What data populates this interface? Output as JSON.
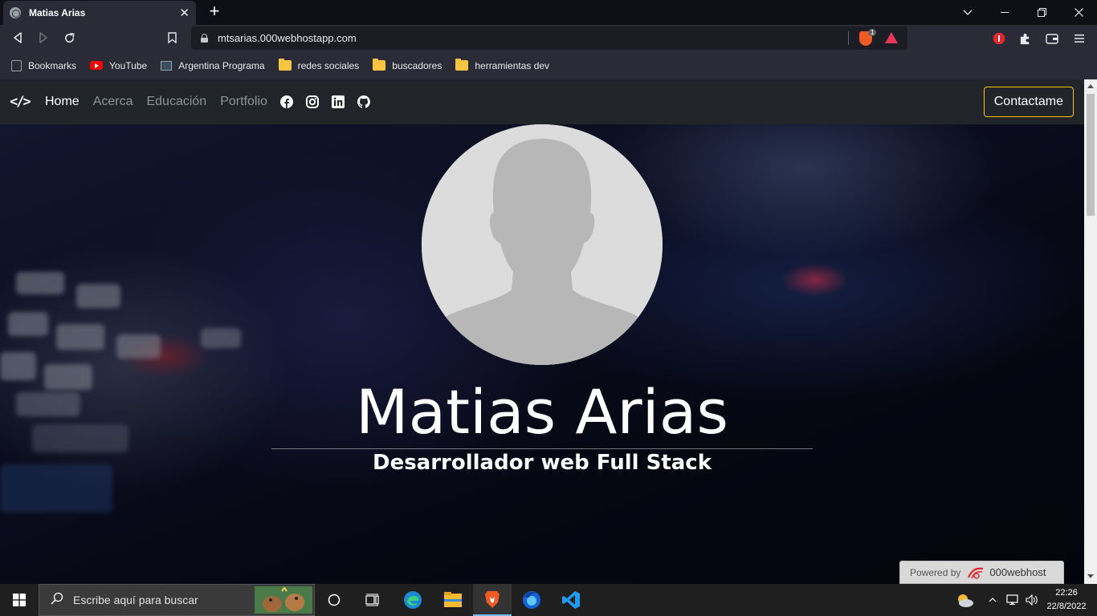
{
  "browser": {
    "tab_title": "Matias Arias",
    "url": "mtsarias.000webhostapp.com",
    "shield_count": "1",
    "bookmarks": [
      {
        "label": "Bookmarks",
        "icon": "bookmarks-icon"
      },
      {
        "label": "YouTube",
        "icon": "youtube-icon"
      },
      {
        "label": "Argentina Programa",
        "icon": "argentina-programa-icon"
      },
      {
        "label": "redes sociales",
        "icon": "folder-icon"
      },
      {
        "label": "buscadores",
        "icon": "folder-icon"
      },
      {
        "label": "herramientas dev",
        "icon": "folder-icon"
      }
    ]
  },
  "site": {
    "brand_symbol": "</>",
    "nav": [
      {
        "label": "Home",
        "active": true
      },
      {
        "label": "Acerca",
        "active": false
      },
      {
        "label": "Educación",
        "active": false
      },
      {
        "label": "Portfolio",
        "active": false
      }
    ],
    "social": [
      "facebook-icon",
      "instagram-icon",
      "linkedin-icon",
      "github-icon"
    ],
    "contact_label": "Contactame",
    "hero_name": "Matias Arias",
    "hero_role": "Desarrollador web Full Stack",
    "powered_by": "Powered by",
    "powered_brand": "000webhost"
  },
  "taskbar": {
    "search_placeholder": "Escribe aquí para buscar",
    "time": "22:26",
    "date": "22/8/2022"
  },
  "colors": {
    "accent_border": "#ffc107",
    "nav_bg": "#212429",
    "chrome_bg": "#2a2b36"
  }
}
